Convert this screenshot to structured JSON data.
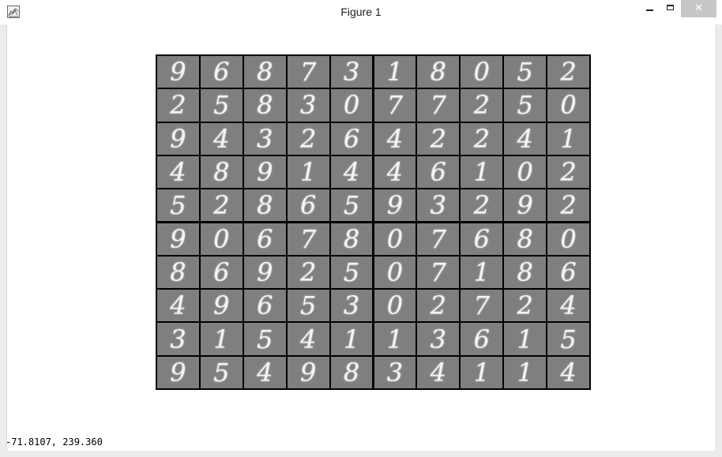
{
  "window": {
    "title": "Figure 1",
    "controls": {
      "minimize": "minimize",
      "maximize": "maximize",
      "close": "✕"
    }
  },
  "figure": {
    "digits": [
      [
        "9",
        "6",
        "8",
        "7",
        "3",
        "1",
        "8",
        "0",
        "5",
        "2"
      ],
      [
        "2",
        "5",
        "8",
        "3",
        "0",
        "7",
        "7",
        "2",
        "5",
        "0"
      ],
      [
        "9",
        "4",
        "3",
        "2",
        "6",
        "4",
        "2",
        "2",
        "4",
        "1"
      ],
      [
        "4",
        "8",
        "9",
        "1",
        "4",
        "4",
        "6",
        "1",
        "0",
        "2"
      ],
      [
        "5",
        "2",
        "8",
        "6",
        "5",
        "9",
        "3",
        "2",
        "9",
        "2"
      ],
      [
        "9",
        "0",
        "6",
        "7",
        "8",
        "0",
        "7",
        "6",
        "8",
        "0"
      ],
      [
        "8",
        "6",
        "9",
        "2",
        "5",
        "0",
        "7",
        "1",
        "8",
        "6"
      ],
      [
        "4",
        "9",
        "6",
        "5",
        "3",
        "0",
        "2",
        "7",
        "2",
        "4"
      ],
      [
        "3",
        "1",
        "5",
        "4",
        "1",
        "1",
        "3",
        "6",
        "1",
        "5"
      ],
      [
        "9",
        "5",
        "4",
        "9",
        "8",
        "3",
        "4",
        "1",
        "1",
        "4"
      ]
    ]
  },
  "status": {
    "coordinates": "-71.8107, 239.360"
  },
  "colors": {
    "cell_background": "#7f7f7f",
    "grid_lines": "#000000",
    "digit_stroke": "#f4f4f4"
  }
}
